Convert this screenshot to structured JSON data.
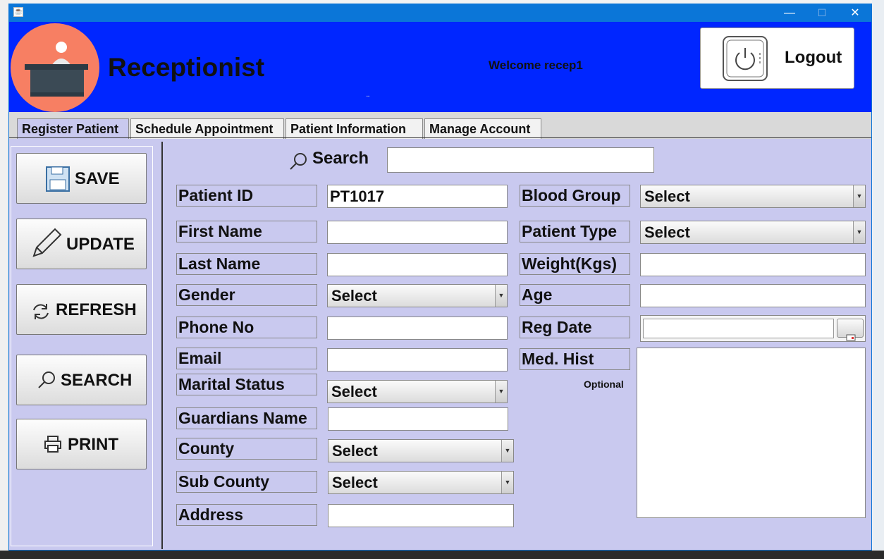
{
  "window": {
    "title_icon": "java-icon",
    "minimize": "—",
    "maximize": "☐",
    "close": "✕"
  },
  "header": {
    "title": "Receptionist",
    "welcome": "Welcome  recep1",
    "logout_label": "Logout",
    "mark": "⠉"
  },
  "tabs": [
    "Register Patient",
    "Schedule Appointment",
    "Patient Information",
    "Manage Account"
  ],
  "active_tab": "Register Patient",
  "sidebar": {
    "save": "SAVE",
    "update": "UPDATE",
    "refresh": "REFRESH",
    "search": "SEARCH",
    "print": "PRINT"
  },
  "search": {
    "label": "Search",
    "value": ""
  },
  "form": {
    "patient_id_label": "Patient ID",
    "patient_id_value": "PT1017",
    "first_name_label": "First Name",
    "last_name_label": "Last Name",
    "gender_label": "Gender",
    "gender_value": "Select",
    "phone_label": "Phone No",
    "email_label": "Email",
    "marital_label": "Marital Status",
    "marital_value": "Select",
    "guardian_label": "Guardians Name",
    "county_label": "County",
    "county_value": "Select",
    "subcounty_label": "Sub County",
    "subcounty_value": "Select",
    "address_label": "Address",
    "blood_group_label": "Blood Group",
    "blood_group_value": "Select",
    "patient_type_label": "Patient Type",
    "patient_type_value": "Select",
    "weight_label": "Weight(Kgs)",
    "age_label": "Age",
    "reg_date_label": "Reg Date",
    "med_hist_label": "Med. Hist",
    "optional_note": "Optional"
  },
  "colors": {
    "header_blue": "#0026ff",
    "panel": "#c9c9ef",
    "titlebar": "#0b76d8",
    "avatar": "#f77f63"
  }
}
